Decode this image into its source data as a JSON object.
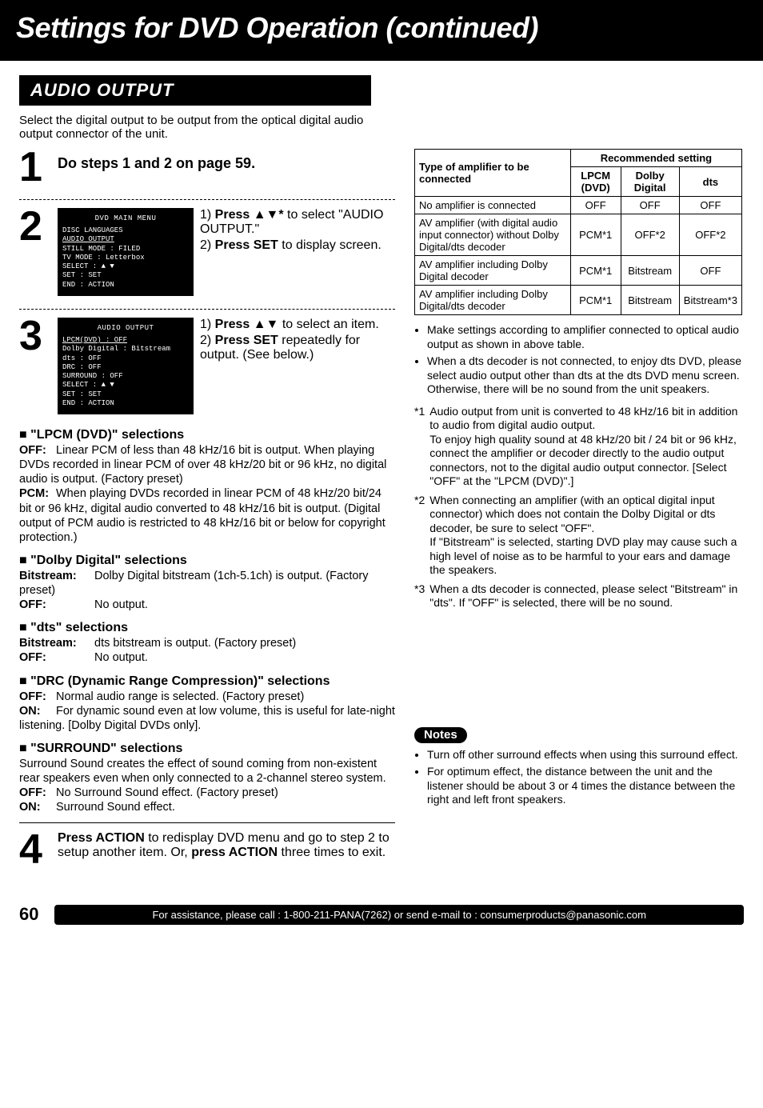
{
  "title": "Settings for DVD Operation (continued)",
  "section_header": "AUDIO OUTPUT",
  "intro": "Select the digital output to be output from the optical digital audio output connector of the unit.",
  "steps": {
    "s1": {
      "num": "1",
      "text": "Do steps 1 and 2 on page 59."
    },
    "s2": {
      "num": "2",
      "osd_title": "DVD MAIN MENU",
      "osd_lines": [
        "DISC LANGUAGES",
        "AUDIO OUTPUT",
        "STILL MODE    : FILED",
        "TV MODE       : Letterbox",
        " ",
        "SELECT  : ▲ ▼",
        "SET     : SET",
        "END     : ACTION"
      ],
      "l1a": "1) ",
      "l1b": "Press ▲▼*",
      "l1c": " to select \"AUDIO OUTPUT.\"",
      "l2a": "2) ",
      "l2b": "Press SET",
      "l2c": " to display screen."
    },
    "s3": {
      "num": "3",
      "osd_title": "AUDIO OUTPUT",
      "osd_lines": [
        "LPCM(DVD)      : OFF",
        "Dolby Digital  : Bitstream",
        "dts            : OFF",
        "DRC            : OFF",
        "SURROUND       : OFF",
        " ",
        "SELECT  : ▲ ▼",
        "SET     : SET",
        "END     : ACTION"
      ],
      "l1a": "1) ",
      "l1b": "Press ▲▼",
      "l1c": " to select an item.",
      "l2a": "2) ",
      "l2b": "Press SET",
      "l2c": " repeatedly for output. (See below.)"
    },
    "s4": {
      "num": "4",
      "l1a": "Press ACTION",
      "l1b": " to redisplay DVD menu and go to step 2 to setup another item. Or, ",
      "l1c": "press ACTION",
      "l1d": " three times to exit."
    }
  },
  "sel": {
    "lpcm": {
      "head": "\"LPCM (DVD)\" selections",
      "off_label": "OFF:",
      "off_text": "Linear PCM of less than 48 kHz/16 bit is output. When playing DVDs recorded in linear PCM of over 48 kHz/20 bit or 96 kHz, no digital audio is output. (Factory preset)",
      "pcm_label": "PCM:",
      "pcm_text": "When playing DVDs recorded in linear PCM of 48 kHz/20 bit/24 bit or 96 kHz, digital audio converted to 48 kHz/16 bit is output. (Digital output of PCM audio is restricted to 48 kHz/16 bit or below for copyright protection.)"
    },
    "dolby": {
      "head": "\"Dolby Digital\" selections",
      "bit_label": "Bitstream:",
      "bit_text": "Dolby Digital bitstream (1ch-5.1ch) is output. (Factory preset)",
      "off_label": "OFF:",
      "off_text": "No output."
    },
    "dts": {
      "head": "\"dts\" selections",
      "bit_label": "Bitstream:",
      "bit_text": "dts bitstream is output. (Factory preset)",
      "off_label": "OFF:",
      "off_text": "No output."
    },
    "drc": {
      "head": "\"DRC (Dynamic Range Compression)\" selections",
      "off_label": "OFF:",
      "off_text": "Normal audio range is selected. (Factory preset)",
      "on_label": "ON:",
      "on_text": "For dynamic sound even at low volume, this is useful for late-night listening. [Dolby Digital DVDs only]."
    },
    "surround": {
      "head": "\"SURROUND\" selections",
      "intro": "Surround Sound creates the effect of sound coming from non-existent rear speakers even when only connected to a 2-channel stereo system.",
      "off_label": "OFF:",
      "off_text": "No Surround Sound effect. (Factory preset)",
      "on_label": "ON:",
      "on_text": "Surround Sound effect."
    }
  },
  "table": {
    "hdr_type": "Type of amplifier to be connected",
    "hdr_rec": "Recommended setting",
    "col_lpcm": "LPCM (DVD)",
    "col_dolby": "Dolby Digital",
    "col_dts": "dts",
    "rows": [
      {
        "type": "No amplifier is connected",
        "lpcm": "OFF",
        "dolby": "OFF",
        "dts": "OFF"
      },
      {
        "type": "AV amplifier (with digital audio input connector) without Dolby Digital/dts decoder",
        "lpcm": "PCM*1",
        "dolby": "OFF*2",
        "dts": "OFF*2"
      },
      {
        "type": "AV amplifier including Dolby Digital decoder",
        "lpcm": "PCM*1",
        "dolby": "Bitstream",
        "dts": "OFF"
      },
      {
        "type": "AV amplifier including Dolby Digital/dts decoder",
        "lpcm": "PCM*1",
        "dolby": "Bitstream",
        "dts": "Bitstream*3"
      }
    ]
  },
  "table_notes": [
    "Make settings according to amplifier connected to optical audio output as shown in above table.",
    "When a dts decoder is not connected, to enjoy dts DVD, please select audio output other than dts at the dts DVD menu screen. Otherwise, there will be no sound from the unit speakers."
  ],
  "footnotes": [
    {
      "mark": "*1",
      "text": "Audio output from unit is converted to 48 kHz/16 bit in addition to audio from digital audio output.\nTo enjoy high quality sound at 48 kHz/20 bit / 24 bit or 96 kHz, connect the amplifier or decoder directly to the audio output connectors, not to the digital audio output connector. [Select \"OFF\" at the \"LPCM (DVD)\".]"
    },
    {
      "mark": "*2",
      "text": "When connecting an amplifier (with an optical digital input connector) which does not contain the Dolby Digital or dts decoder, be sure to select \"OFF\".\nIf \"Bitstream\" is selected, starting DVD play may cause such a high level of noise as to be harmful to your ears and damage the speakers."
    },
    {
      "mark": "*3",
      "text": "When a dts decoder is connected, please select \"Bitstream\" in \"dts\". If \"OFF\" is selected, there will be no sound."
    }
  ],
  "notes_badge": "Notes",
  "notes": [
    "Turn off other surround effects when using this surround effect.",
    "For optimum effect, the distance between the unit and the listener should be about 3 or 4 times the distance between the right and left front speakers."
  ],
  "footer": {
    "page": "60",
    "assist": "For assistance, please call : 1-800-211-PANA(7262) or send e-mail to : consumerproducts@panasonic.com"
  }
}
